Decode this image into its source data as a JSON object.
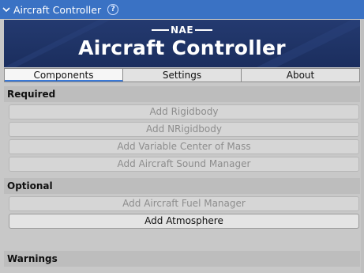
{
  "header": {
    "title": "Aircraft Controller",
    "help_icon": "?"
  },
  "banner": {
    "brand": "NAE",
    "title": "Aircraft Controller"
  },
  "tabs": [
    {
      "label": "Components",
      "active": true
    },
    {
      "label": "Settings",
      "active": false
    },
    {
      "label": "About",
      "active": false
    }
  ],
  "required": {
    "heading": "Required",
    "buttons": [
      {
        "label": "Add Rigidbody",
        "enabled": false
      },
      {
        "label": "Add NRigidbody",
        "enabled": false
      },
      {
        "label": "Add Variable Center of Mass",
        "enabled": false
      },
      {
        "label": "Add Aircraft Sound Manager",
        "enabled": false
      }
    ]
  },
  "optional": {
    "heading": "Optional",
    "buttons": [
      {
        "label": "Add Aircraft Fuel Manager",
        "enabled": false
      },
      {
        "label": "Add Atmosphere",
        "enabled": true
      }
    ]
  },
  "warnings": {
    "heading": "Warnings"
  },
  "colors": {
    "header_bg": "#3a72c4",
    "banner_bg": "#1f3466",
    "active_tab_underline": "#3a79d8"
  }
}
